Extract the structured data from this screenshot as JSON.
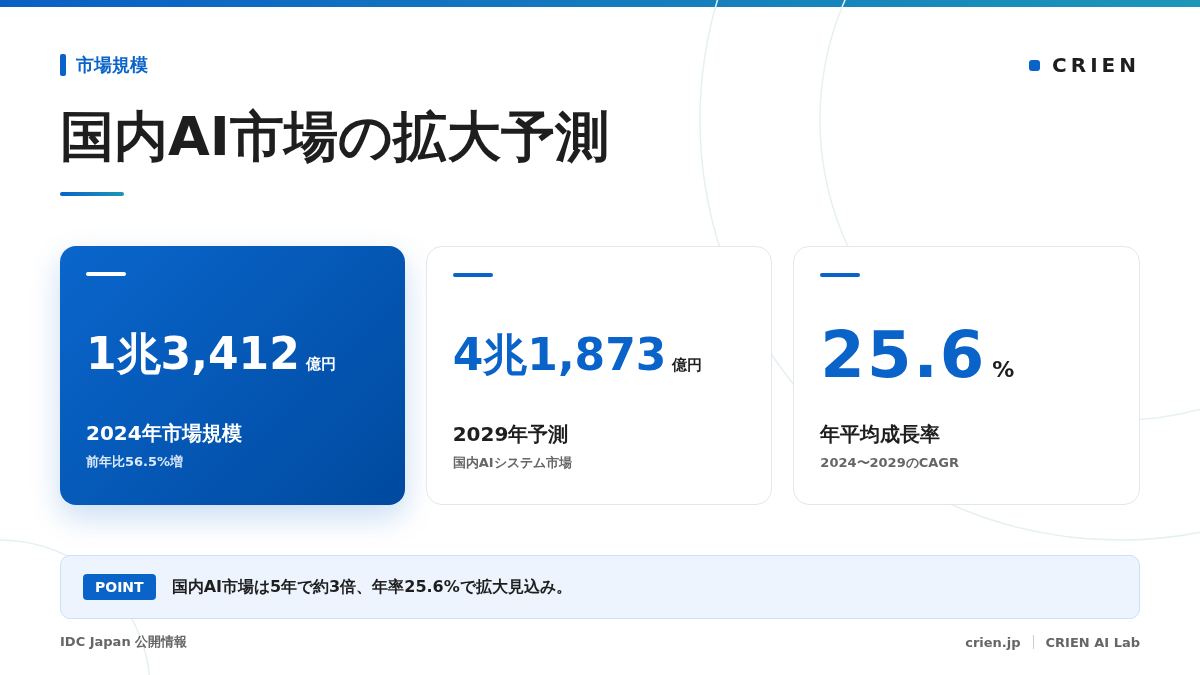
{
  "section_label": "市場規模",
  "brand": "CRIEN",
  "title": "国内AI市場の拡大予測",
  "cards": [
    {
      "kind": "featured",
      "value": "1兆3,412",
      "unit": "億円",
      "label": "2024年市場規模",
      "note": "前年比56.5%増"
    },
    {
      "kind": "plain",
      "value": "4兆1,873",
      "unit": "億円",
      "label": "2029年予測",
      "note": "国内AIシステム市場"
    },
    {
      "kind": "large",
      "value": "25.6",
      "unit": "%",
      "label": "年平均成長率",
      "note": "2024〜2029のCAGR"
    }
  ],
  "point": {
    "badge": "POINT",
    "text": "国内AI市場は5年で約3倍、年率25.6%で拡大見込み。"
  },
  "footer": {
    "source": "IDC Japan 公開情報",
    "links": [
      "crien.jp",
      "CRIEN AI Lab"
    ]
  }
}
